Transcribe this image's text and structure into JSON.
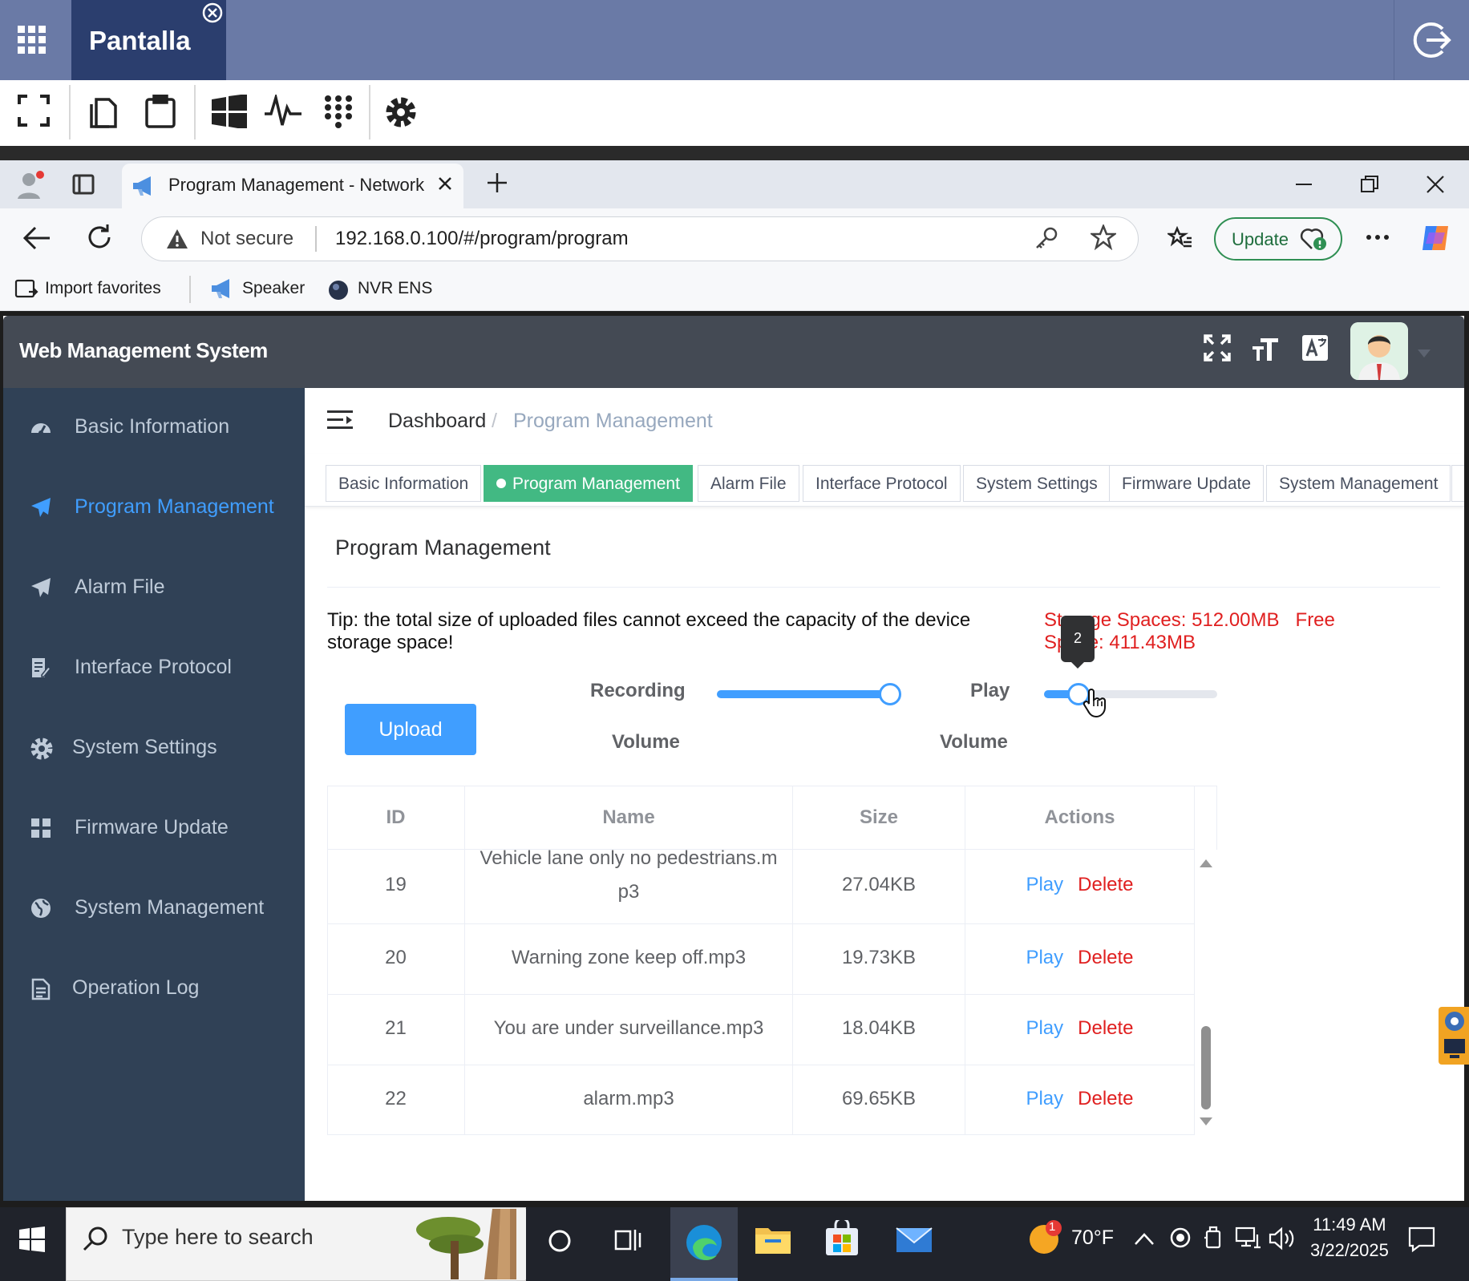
{
  "remote_desktop": {
    "tab_title": "Pantalla"
  },
  "browser": {
    "tab_title": "Program Management - Network",
    "not_secure": "Not secure",
    "url": "192.168.0.100/#/program/program",
    "update_label": "Update",
    "favorites": [
      "Import favorites",
      "Speaker",
      "NVR ENS"
    ]
  },
  "app": {
    "title": "Web Management System",
    "sidebar": [
      {
        "label": "Basic Information",
        "icon": "dashboard-icon"
      },
      {
        "label": "Program Management",
        "icon": "paper-plane-icon"
      },
      {
        "label": "Alarm File",
        "icon": "paper-plane-icon"
      },
      {
        "label": "Interface Protocol",
        "icon": "document-edit-icon"
      },
      {
        "label": "System Settings",
        "icon": "gear-icon"
      },
      {
        "label": "Firmware Update",
        "icon": "grid-icon"
      },
      {
        "label": "System Management",
        "icon": "globe-icon"
      },
      {
        "label": "Operation Log",
        "icon": "document-icon"
      }
    ],
    "active_sidebar": "Program Management",
    "breadcrumb": {
      "home": "Dashboard",
      "separator": "/",
      "current": "Program Management"
    },
    "tags": [
      "Basic Information",
      "Program Management",
      "Alarm File",
      "Interface Protocol",
      "System Settings",
      "Firmware Update",
      "System Management"
    ],
    "active_tag": "Program Management",
    "card_title": "Program Management",
    "tip": "Tip: the total size of uploaded files cannot exceed the capacity of the device storage space!",
    "storage_spaces": "Storage Spaces: 512.00MB",
    "free_space": "Free Space: 411.43MB",
    "upload_label": "Upload",
    "recording_volume": {
      "label_line1": "Recording",
      "label_line2": "Volume",
      "fraction": 1.0
    },
    "play_volume": {
      "label_line1": "Play",
      "label_line2": "Volume",
      "fraction": 0.2,
      "tooltip": "2"
    },
    "table": {
      "columns": [
        "ID",
        "Name",
        "Size",
        "Actions"
      ],
      "rows": [
        {
          "id": "19",
          "name": "Vehicle lane only no pedestrians.mp3",
          "size": "27.04KB"
        },
        {
          "id": "20",
          "name": "Warning zone keep off.mp3",
          "size": "19.73KB"
        },
        {
          "id": "21",
          "name": "You are under surveillance.mp3",
          "size": "18.04KB"
        },
        {
          "id": "22",
          "name": "alarm.mp3",
          "size": "69.65KB"
        }
      ],
      "action_play": "Play",
      "action_delete": "Delete"
    }
  },
  "taskbar": {
    "search_placeholder": "Type here to search",
    "temperature": "70°F",
    "weather_badge": "1",
    "time": "11:49 AM",
    "date": "3/22/2025"
  },
  "colors": {
    "accent": "#409eff",
    "sidebar_bg": "#304156",
    "active_tag": "#42b983",
    "danger": "#e02020"
  }
}
